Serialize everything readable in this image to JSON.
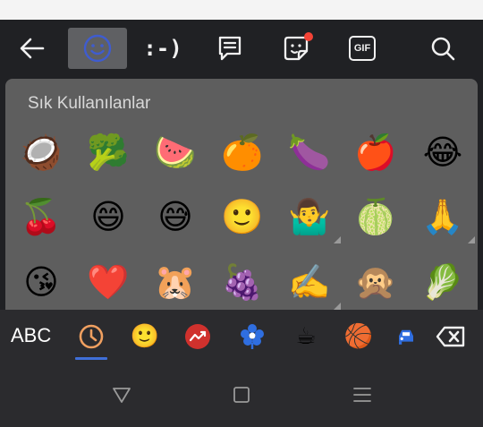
{
  "toolbar": {
    "items": [
      {
        "name": "back-arrow-icon"
      },
      {
        "name": "emoji-smiley-icon",
        "active": true
      },
      {
        "name": "emoticon-icon",
        "text": ":-)"
      },
      {
        "name": "clipboard-icon"
      },
      {
        "name": "sticker-icon",
        "badge": true
      },
      {
        "name": "gif-icon",
        "text": "GIF"
      },
      {
        "name": "search-icon"
      }
    ],
    "active_color": "#3f5ccf",
    "badge_color": "#f44336"
  },
  "panel": {
    "title": "Sık Kullanılanlar",
    "rows": [
      [
        "🥥",
        "🥦",
        "🍉",
        "🍊",
        "🍆",
        "🍎",
        "😂"
      ],
      [
        "🍒",
        "😄",
        "😅",
        "🙂",
        "🤷‍♂️",
        "🍈",
        "🙏"
      ],
      [
        "😘",
        "❤️",
        "🐹",
        "🍇",
        "✍️",
        "🙊",
        "🥬"
      ]
    ]
  },
  "category_bar": {
    "abc_label": "ABC",
    "categories": [
      {
        "name": "recent-clock-icon",
        "active": true
      },
      {
        "name": "smileys-icon",
        "glyph": "🙂"
      },
      {
        "name": "trending-icon"
      },
      {
        "name": "nature-flower-icon"
      },
      {
        "name": "food-drink-icon",
        "glyph": "☕"
      },
      {
        "name": "activity-ball-icon",
        "glyph": "🏀"
      },
      {
        "name": "travel-car-icon"
      }
    ]
  },
  "navbar": {
    "buttons": [
      "back-triangle-icon",
      "home-square-icon",
      "recents-menu-icon"
    ]
  }
}
